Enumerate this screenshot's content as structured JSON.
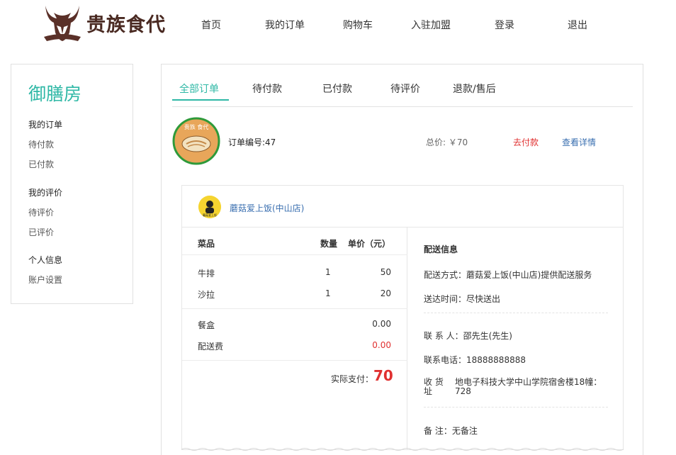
{
  "header": {
    "logo_text": "贵族食代",
    "nav": [
      "首页",
      "我的订单",
      "购物车",
      "入驻加盟",
      "登录",
      "退出"
    ]
  },
  "sidebar": {
    "title": "御膳房",
    "items": [
      {
        "label": "我的订单",
        "type": "head"
      },
      {
        "label": "待付款",
        "type": "sub"
      },
      {
        "label": "已付款",
        "type": "sub"
      },
      {
        "label": "我的评价",
        "type": "head"
      },
      {
        "label": "待评价",
        "type": "sub"
      },
      {
        "label": "已评价",
        "type": "sub"
      },
      {
        "label": "个人信息",
        "type": "head"
      },
      {
        "label": "账户设置",
        "type": "sub"
      }
    ]
  },
  "tabs": [
    "全部订单",
    "待付款",
    "已付款",
    "待评价",
    "退款/售后"
  ],
  "order": {
    "number_text": "订单编号:47",
    "total_text": "总价: ￥70",
    "pay_label": "去付款",
    "detail_label": "查看详情",
    "image_caption": "贵族 食代"
  },
  "shop": {
    "name": "蘑菇爱上饭(中山店)",
    "icon_label": "蘑菇爱上饭"
  },
  "items_table": {
    "headers": [
      "菜品",
      "数量",
      "单价（元）"
    ],
    "rows": [
      {
        "name": "牛排",
        "qty": "1",
        "price": "50"
      },
      {
        "name": "沙拉",
        "qty": "1",
        "price": "20"
      }
    ],
    "box_fee_label": "餐盒",
    "box_fee": "0.00",
    "delivery_fee_label": "配送费",
    "delivery_fee": "0.00",
    "actual_pay_label": "实际支付：",
    "actual_pay": "70"
  },
  "delivery": {
    "title": "配送信息",
    "method": "配送方式：蘑菇爱上饭(中山店)提供配送服务",
    "time": "送达时间：尽快送出",
    "contact": "联 系 人：邵先生(先生)",
    "phone": "联系电话：18888888888",
    "address_label": "收 货 址",
    "address": "地电子科技大学中山学院宿舍楼18幢：728",
    "note": "备 注：无备注"
  },
  "colors": {
    "accent": "#2fb8a6",
    "price_red": "#e03030",
    "link_blue": "#3a6fb0"
  }
}
